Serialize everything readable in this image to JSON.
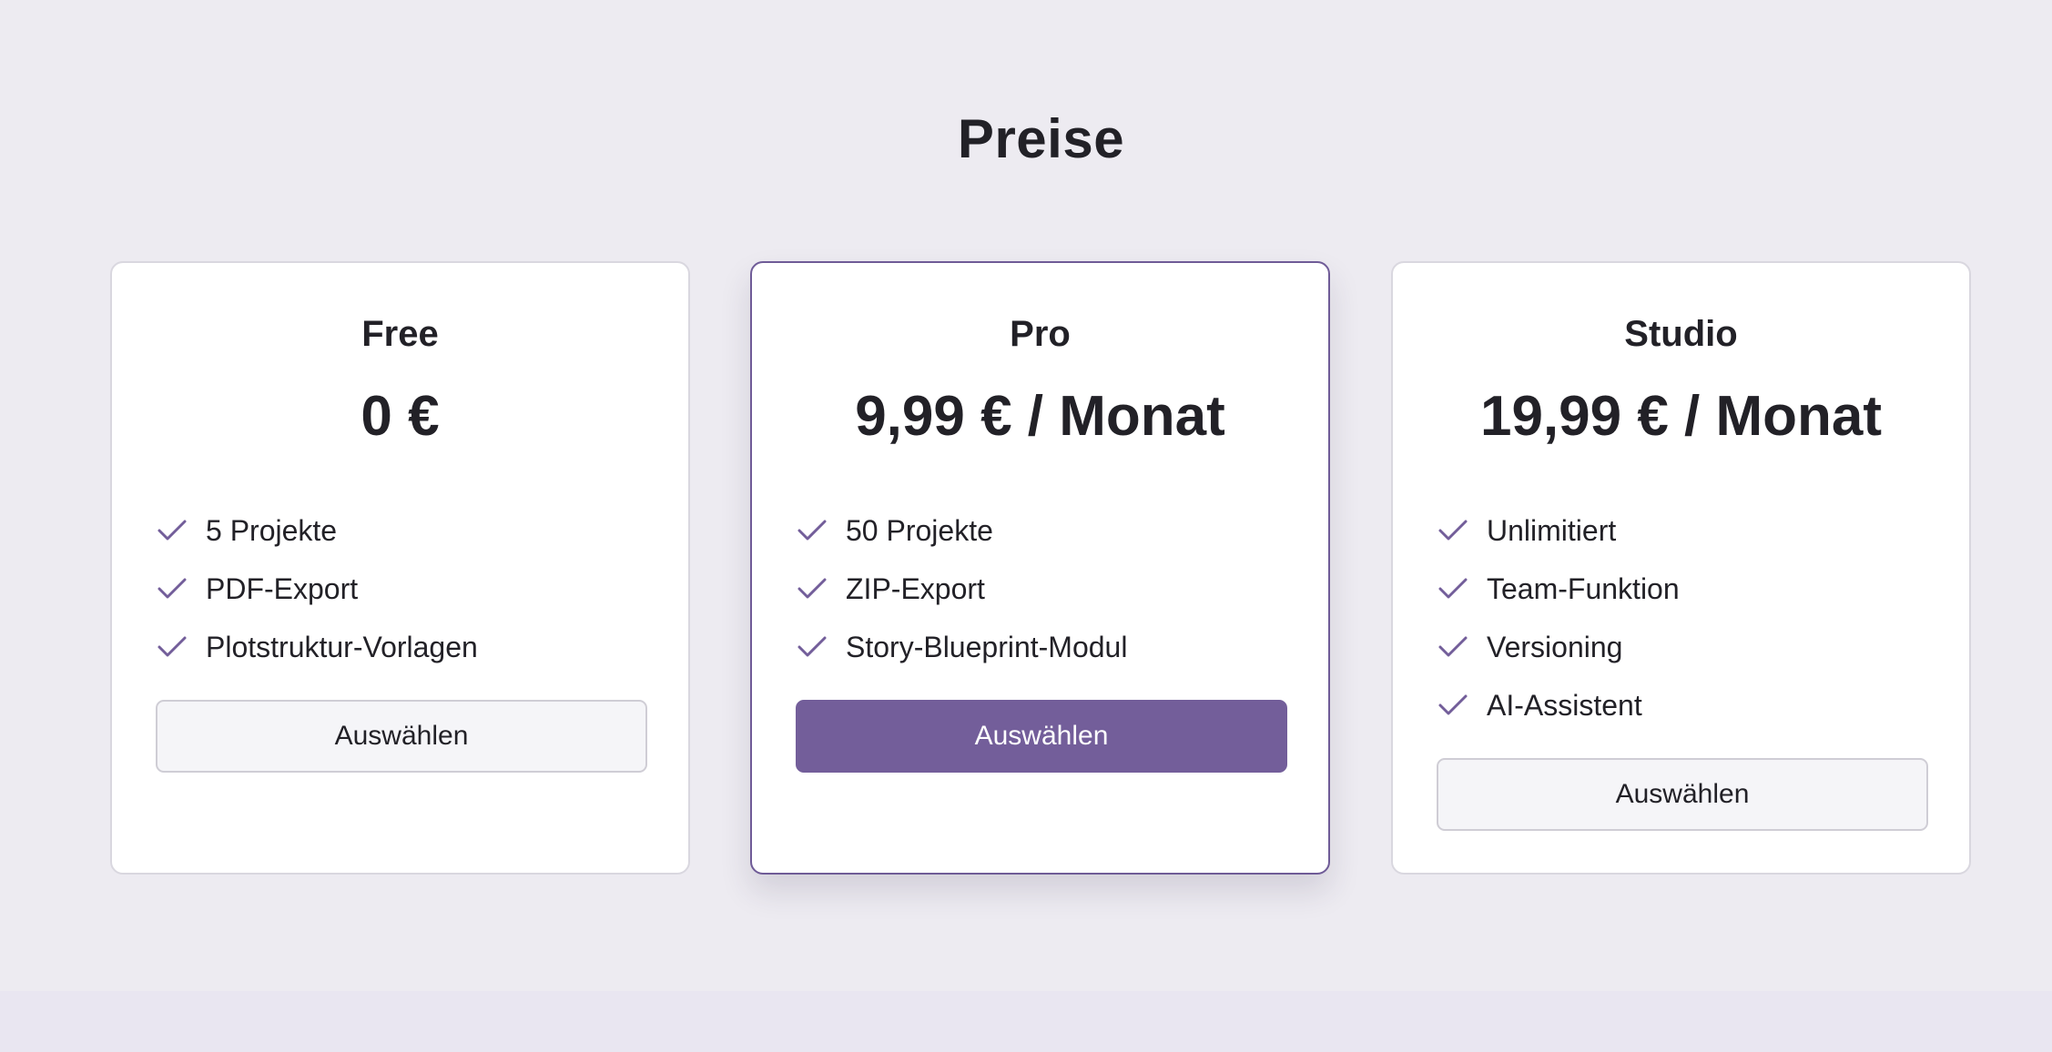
{
  "page": {
    "title": "Preise"
  },
  "plans": [
    {
      "name": "Free",
      "price": "0 €",
      "features": [
        "5 Projekte",
        "PDF-Export",
        "Plotstruktur-Vorlagen"
      ],
      "button_label": "Auswählen",
      "button_style": "secondary",
      "featured": false
    },
    {
      "name": "Pro",
      "price": "9,99 € / Monat",
      "features": [
        "50 Projekte",
        "ZIP-Export",
        "Story-Blueprint-Modul"
      ],
      "button_label": "Auswählen",
      "button_style": "primary",
      "featured": true
    },
    {
      "name": "Studio",
      "price": "19,99 € / Monat",
      "features": [
        "Unlimitiert",
        "Team-Funktion",
        "Versioning",
        "AI-Assistent"
      ],
      "button_label": "Auswählen",
      "button_style": "secondary",
      "featured": false
    }
  ],
  "icons": {
    "feature_bullet": "check-icon"
  },
  "colors": {
    "accent": "#735e9a",
    "background": "#edebf1",
    "text": "#222127"
  }
}
